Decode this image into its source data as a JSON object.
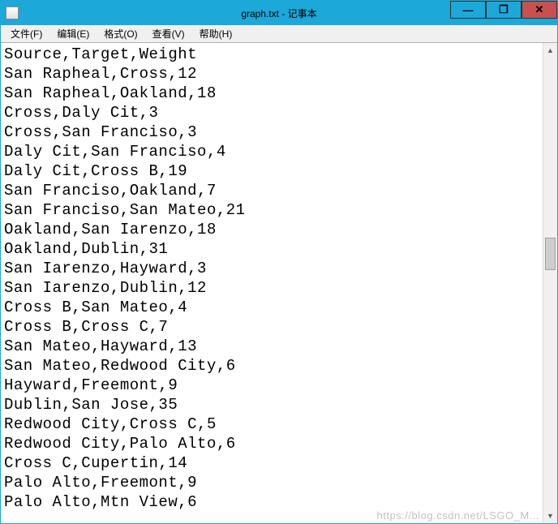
{
  "window": {
    "title": "graph.txt - 记事本"
  },
  "menu": {
    "file": "文件(F)",
    "edit": "编辑(E)",
    "format": "格式(O)",
    "view": "查看(V)",
    "help": "帮助(H)"
  },
  "content": "Source,Target,Weight\nSan Rapheal,Cross,12\nSan Rapheal,Oakland,18\nCross,Daly Cit,3\nCross,San Franciso,3\nDaly Cit,San Franciso,4\nDaly Cit,Cross B,19\nSan Franciso,Oakland,7\nSan Franciso,San Mateo,21\nOakland,San Iarenzo,18\nOakland,Dublin,31\nSan Iarenzo,Hayward,3\nSan Iarenzo,Dublin,12\nCross B,San Mateo,4\nCross B,Cross C,7\nSan Mateo,Hayward,13\nSan Mateo,Redwood City,6\nHayward,Freemont,9\nDublin,San Jose,35\nRedwood City,Cross C,5\nRedwood City,Palo Alto,6\nCross C,Cupertin,14\nPalo Alto,Freemont,9\nPalo Alto,Mtn View,6",
  "watermark": "https://blog.csdn.net/LSGO_M...",
  "controls": {
    "minimize": "—",
    "maximize": "❐",
    "close": "✕"
  },
  "scroll": {
    "up": "▲",
    "down": "▼"
  }
}
